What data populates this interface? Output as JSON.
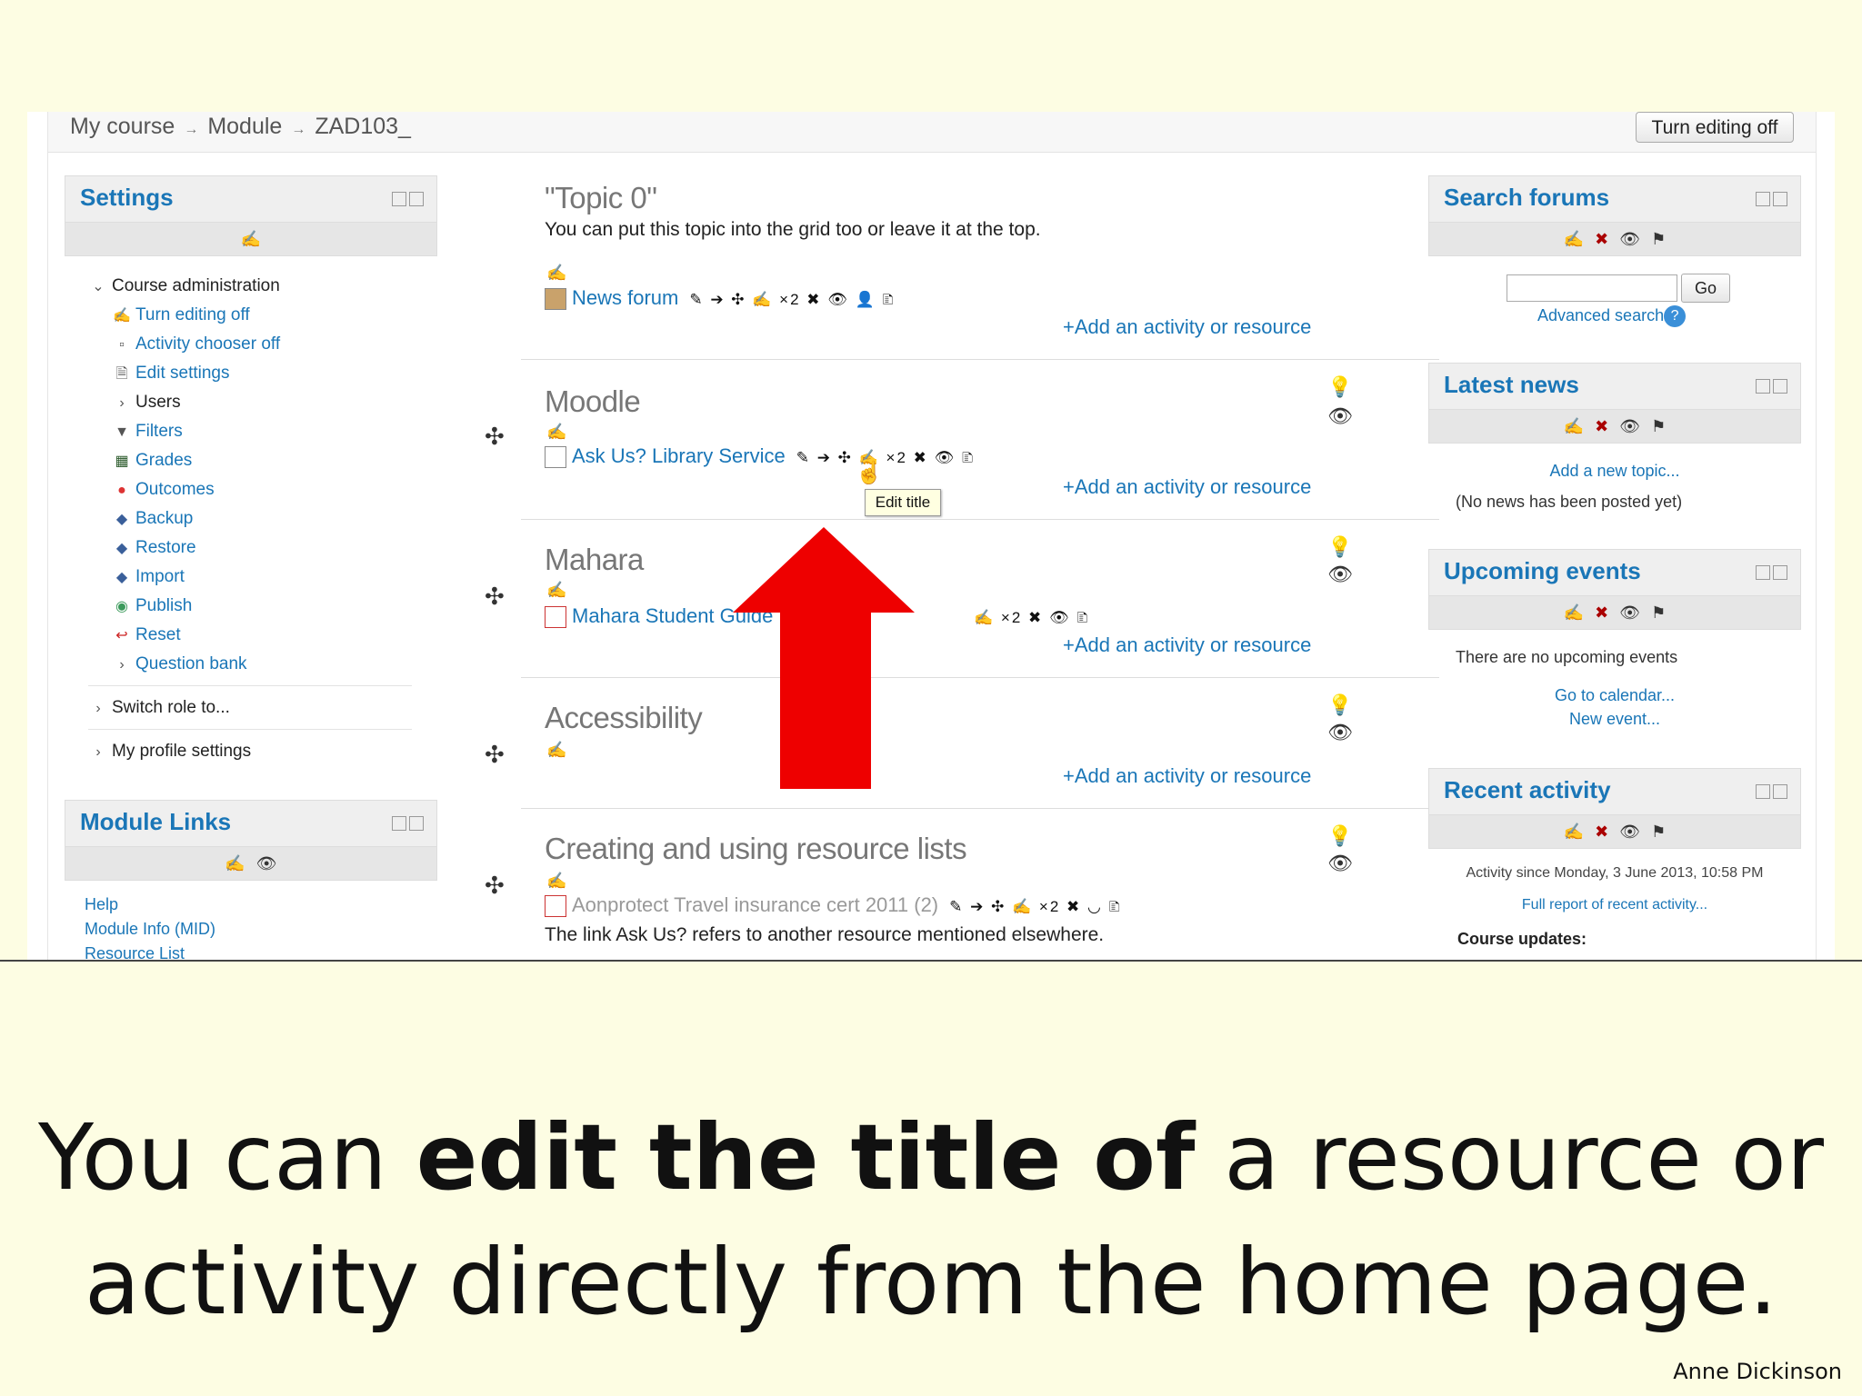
{
  "breadcrumb": {
    "items": [
      "My course",
      "Module",
      "ZAD103_"
    ],
    "sep": "→"
  },
  "header": {
    "turn_editing_off": "Turn editing off"
  },
  "settings": {
    "title": "Settings",
    "course_admin": "Course administration",
    "items": [
      {
        "label": "Turn editing off",
        "icon": "edit-icon"
      },
      {
        "label": "Activity chooser off",
        "icon": "square-bullet"
      },
      {
        "label": "Edit settings",
        "icon": "document-icon"
      },
      {
        "label": "Users",
        "icon": "chevron"
      },
      {
        "label": "Filters",
        "icon": "filter-icon"
      },
      {
        "label": "Grades",
        "icon": "grades-icon"
      },
      {
        "label": "Outcomes",
        "icon": "outcomes-icon"
      },
      {
        "label": "Backup",
        "icon": "backup-icon"
      },
      {
        "label": "Restore",
        "icon": "restore-icon"
      },
      {
        "label": "Import",
        "icon": "import-icon"
      },
      {
        "label": "Publish",
        "icon": "globe-icon"
      },
      {
        "label": "Reset",
        "icon": "reset-icon"
      },
      {
        "label": "Question bank",
        "icon": "chevron"
      }
    ],
    "switch_role": "Switch role to...",
    "profile_settings": "My profile settings"
  },
  "module_links": {
    "title": "Module Links",
    "items": [
      "Help",
      "Module Info (MID)",
      "Resource List"
    ]
  },
  "sections": [
    {
      "title": "\"Topic 0\"",
      "summary": "You can put this topic into the grid too or leave it at the top.",
      "activity": "News forum",
      "tools": "✎ ➔ ✣ ✍ ×2 ✖ 👁 👤 🗈",
      "add": "+Add an activity or resource"
    },
    {
      "title": "Moodle",
      "activity": "Ask Us? Library Service",
      "tools": "✎ ➔ ✣ ✍ ×2 ✖ 👁 🗈",
      "add": "+Add an activity or resource"
    },
    {
      "title": "Mahara",
      "activity": "Mahara Student Guide",
      "tools": "✍ ×2 ✖ 👁 🗈",
      "add": "+Add an activity or resource"
    },
    {
      "title": "Accessibility",
      "add": "+Add an activity or resource"
    },
    {
      "title": "Creating and using resource lists",
      "activity": "Aonprotect Travel insurance cert 2011 (2)",
      "tools": "✎ ➔ ✣ ✍ ×2 ✖ ◡ 🗈",
      "note": "The link Ask Us? refers to another resource mentioned elsewhere."
    }
  ],
  "tooltip": "Edit title",
  "search_forums": {
    "title": "Search forums",
    "go": "Go",
    "advanced": "Advanced search",
    "help": "?"
  },
  "latest_news": {
    "title": "Latest news",
    "add_topic": "Add a new topic...",
    "empty": "(No news has been posted yet)"
  },
  "upcoming_events": {
    "title": "Upcoming events",
    "empty": "There are no upcoming events",
    "calendar": "Go to calendar...",
    "new_event": "New event..."
  },
  "recent_activity": {
    "title": "Recent activity",
    "since": "Activity since Monday, 3 June 2013, 10:58 PM",
    "full_report": "Full report of recent activity...",
    "course_updates": "Course updates:"
  },
  "caption": {
    "part1": "You can ",
    "bold": "edit the title of",
    "part2": " a resource or activity directly from the home page."
  },
  "author": "Anne Dickinson",
  "colors": {
    "link": "#1a76b7",
    "arrow": "#ee0000",
    "slide_bg": "#fdfde3"
  }
}
